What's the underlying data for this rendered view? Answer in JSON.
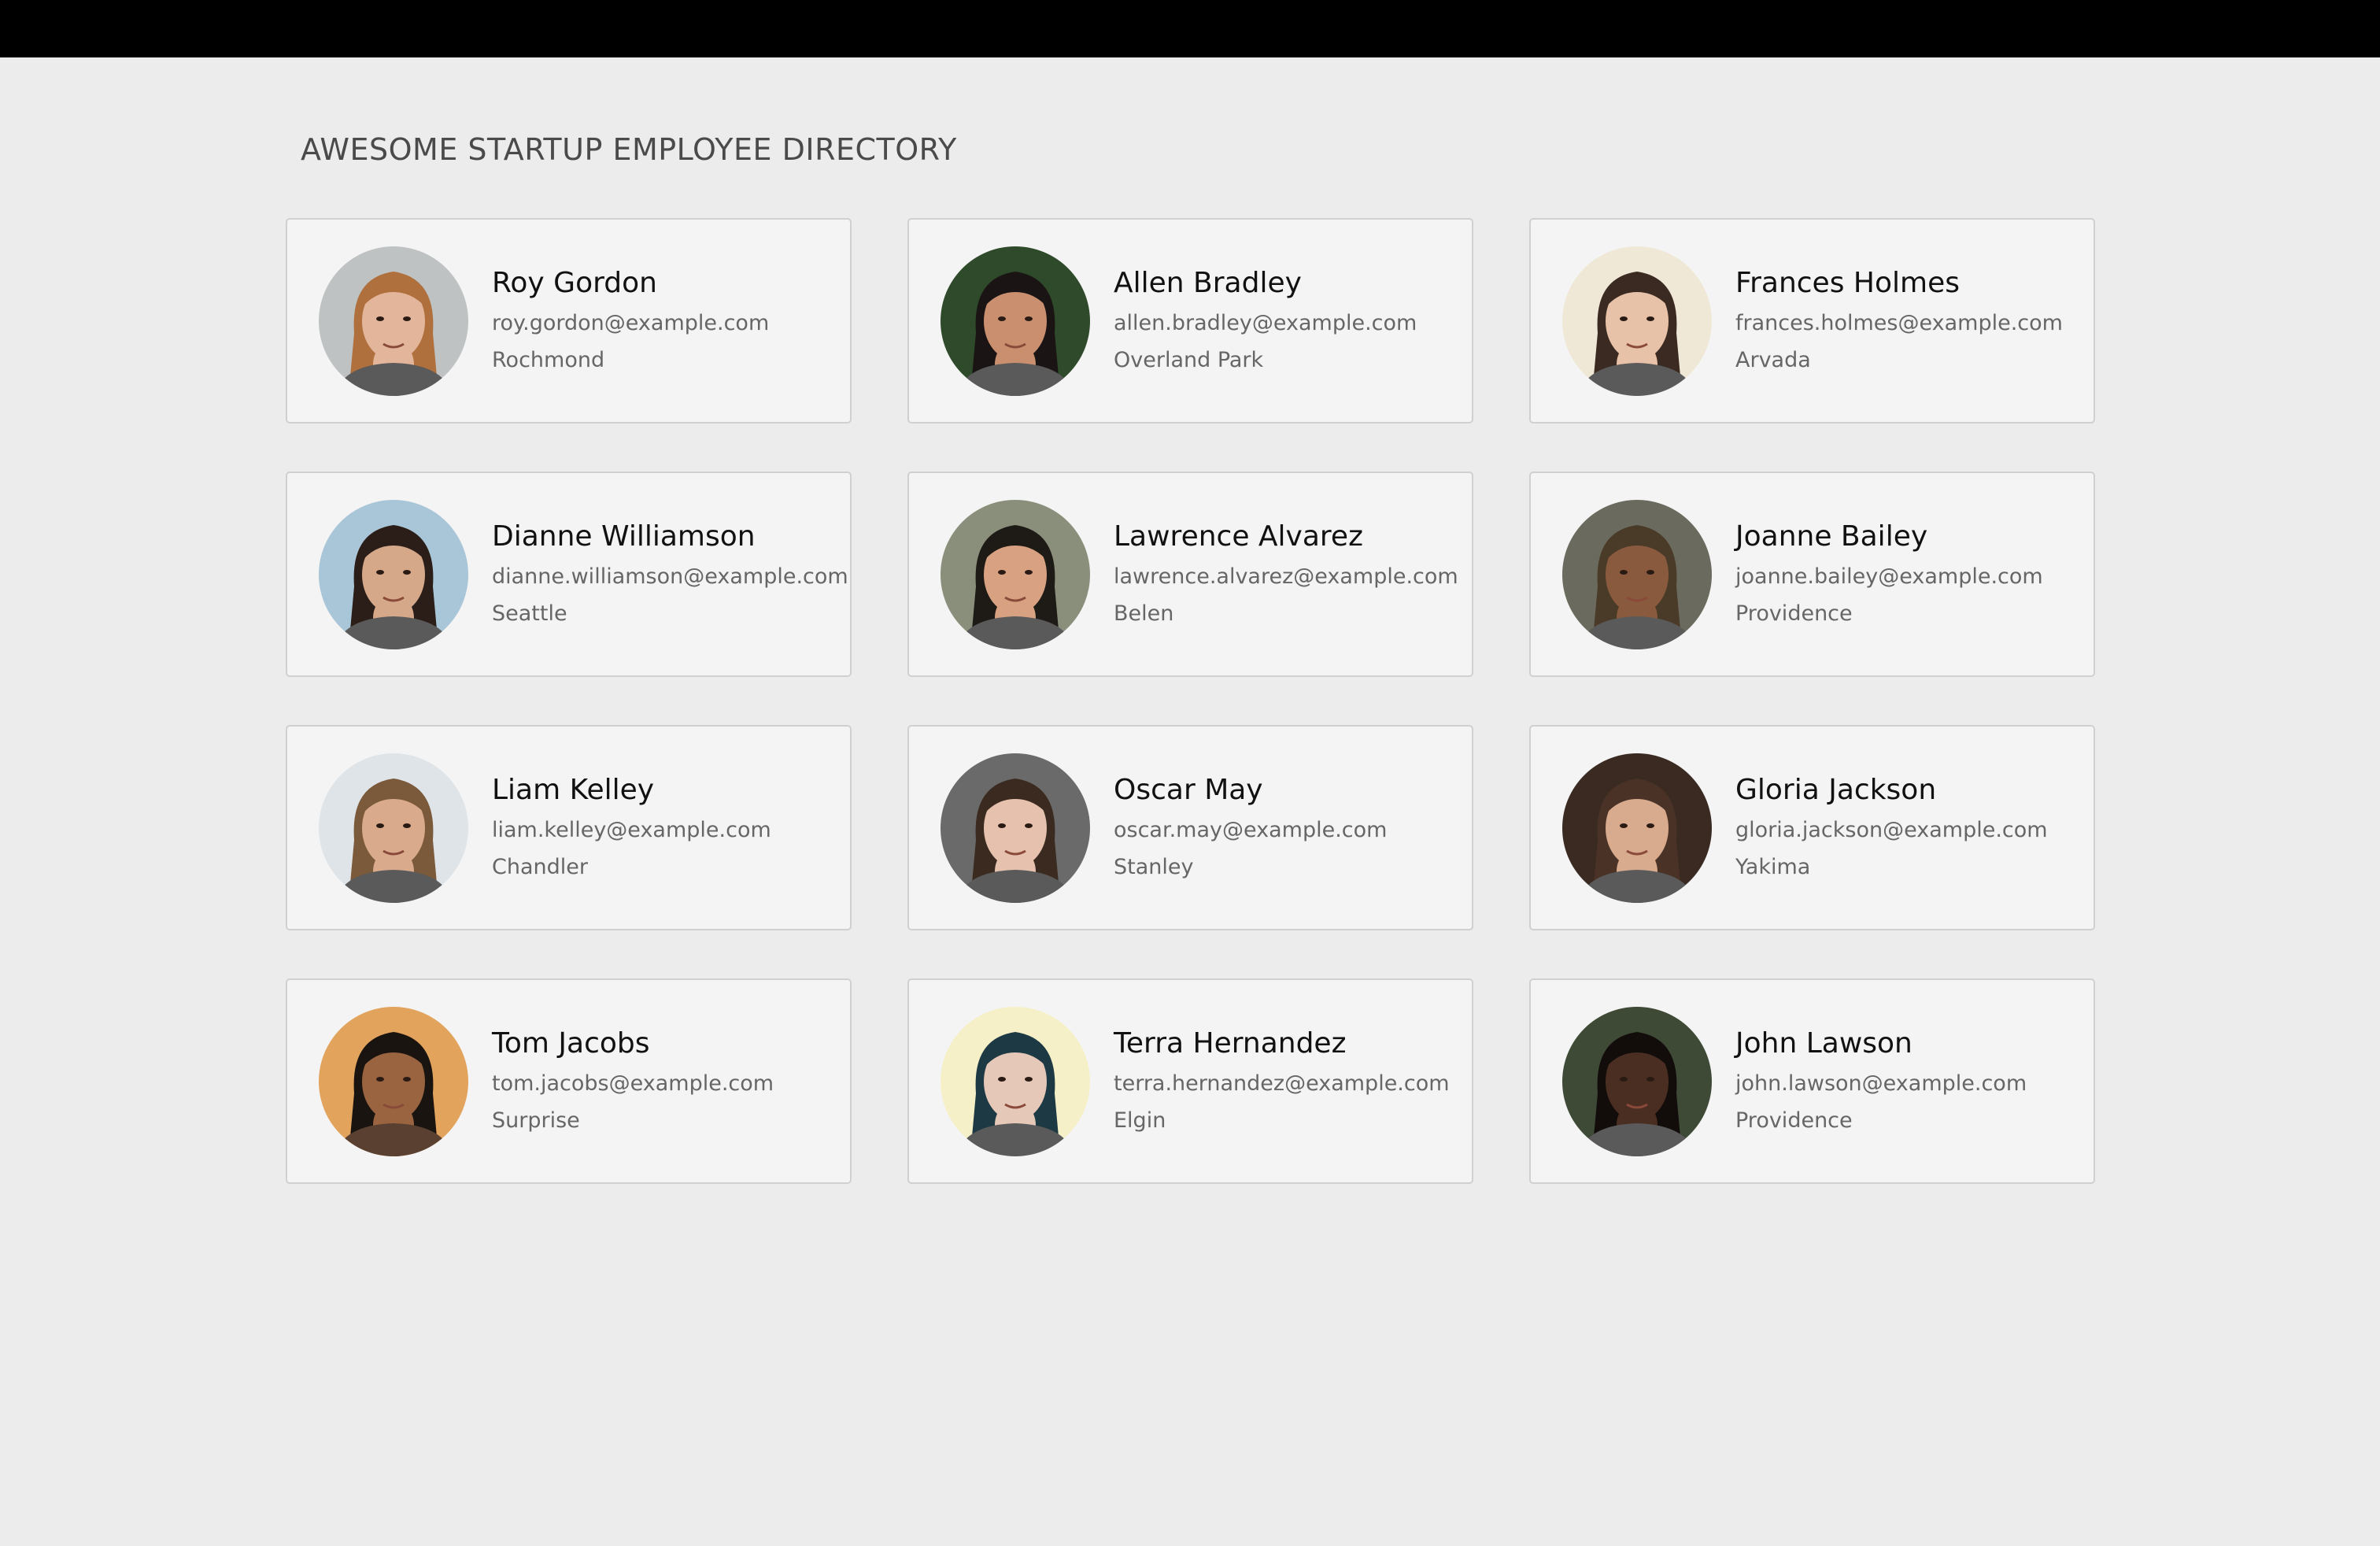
{
  "page": {
    "title": "AWESOME STARTUP EMPLOYEE DIRECTORY"
  },
  "employees": [
    {
      "name": "Roy Gordon",
      "email": "roy.gordon@example.com",
      "city": "Rochmond",
      "avatar_bg": "#bfc2c3",
      "skin": "#e3b69c",
      "hair": "#b0703e"
    },
    {
      "name": "Allen Bradley",
      "email": "allen.bradley@example.com",
      "city": "Overland Park",
      "avatar_bg": "#2f4a2a",
      "skin": "#c98f6e",
      "hair": "#1a1414"
    },
    {
      "name": "Frances Holmes",
      "email": "frances.holmes@example.com",
      "city": "Arvada",
      "avatar_bg": "#efe8d6",
      "skin": "#e8c2a8",
      "hair": "#3a2a22"
    },
    {
      "name": "Dianne Williamson",
      "email": "dianne.williamson@example.com",
      "city": "Seattle",
      "avatar_bg": "#a9c6d8",
      "skin": "#d6a88a",
      "hair": "#2b1d17"
    },
    {
      "name": "Lawrence Alvarez",
      "email": "lawrence.alvarez@example.com",
      "city": "Belen",
      "avatar_bg": "#8a8f7c",
      "skin": "#d8a282",
      "hair": "#1e1a16"
    },
    {
      "name": "Joanne Bailey",
      "email": "joanne.bailey@example.com",
      "city": "Providence",
      "avatar_bg": "#6b6a5e",
      "skin": "#8a5a3e",
      "hair": "#4a3a28"
    },
    {
      "name": "Liam Kelley",
      "email": "liam.kelley@example.com",
      "city": "Chandler",
      "avatar_bg": "#dfe4e8",
      "skin": "#d9aa8c",
      "hair": "#7a5a3a"
    },
    {
      "name": "Oscar May",
      "email": "oscar.may@example.com",
      "city": "Stanley",
      "avatar_bg": "#6a6a6a",
      "skin": "#e6c2ae",
      "hair": "#3a2a20"
    },
    {
      "name": "Gloria Jackson",
      "email": "gloria.jackson@example.com",
      "city": "Yakima",
      "avatar_bg": "#3a2a22",
      "skin": "#d8ab8e",
      "hair": "#4a3226"
    },
    {
      "name": "Tom Jacobs",
      "email": "tom.jacobs@example.com",
      "city": "Surprise",
      "avatar_bg": "#e2a35c",
      "skin": "#9a6440",
      "hair": "#1a1410"
    },
    {
      "name": "Terra Hernandez",
      "email": "terra.hernandez@example.com",
      "city": "Elgin",
      "avatar_bg": "#f6f0c8",
      "skin": "#e6c8b8",
      "hair": "#1d3a44"
    },
    {
      "name": "John Lawson",
      "email": "john.lawson@example.com",
      "city": "Providence",
      "avatar_bg": "#3e4a36",
      "skin": "#4a2e22",
      "hair": "#120c0a"
    }
  ]
}
